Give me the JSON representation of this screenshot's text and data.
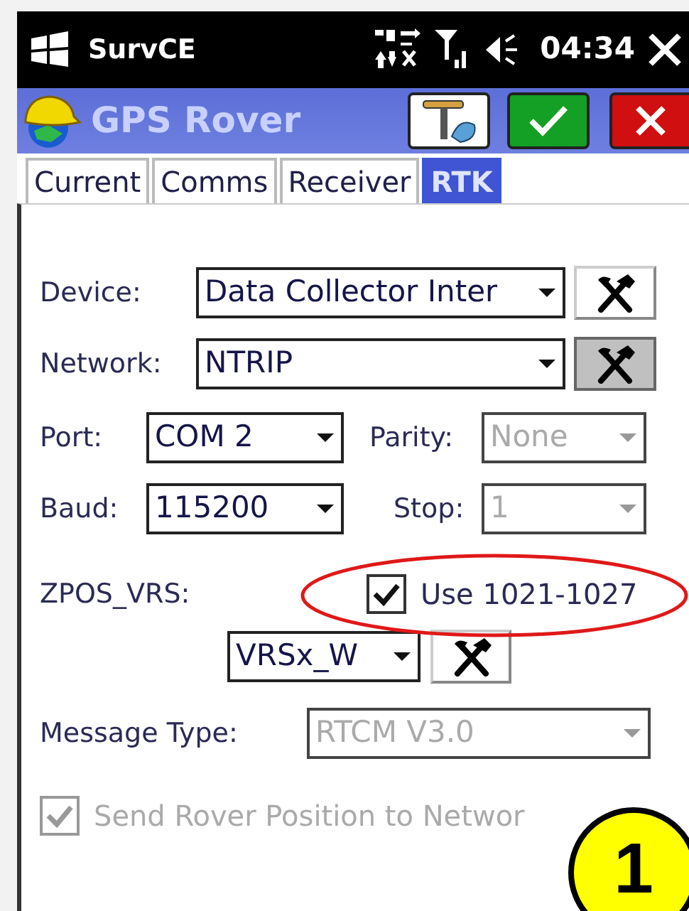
{
  "status_bar": {
    "app_name": "SurvCE",
    "time": "04:34"
  },
  "title_bar": {
    "title": "GPS Rover"
  },
  "tabs": [
    {
      "label": "Current",
      "selected": false
    },
    {
      "label": "Comms",
      "selected": false
    },
    {
      "label": "Receiver",
      "selected": false
    },
    {
      "label": "RTK",
      "selected": true
    }
  ],
  "rows": [
    {
      "items": [
        {
          "kind": "label",
          "text": "Device:"
        },
        {
          "kind": "select",
          "value": "Data Collector Inter",
          "disabled": false
        },
        {
          "kind": "tool",
          "pressed": false
        }
      ]
    },
    {
      "items": [
        {
          "kind": "label",
          "text": "Network:"
        },
        {
          "kind": "select",
          "value": "NTRIP",
          "disabled": false
        },
        {
          "kind": "tool",
          "pressed": true
        }
      ]
    },
    {
      "items": [
        {
          "kind": "label",
          "text": "Port:"
        },
        {
          "kind": "select",
          "value": "COM 2",
          "disabled": false
        },
        {
          "kind": "label",
          "text": "Parity:"
        },
        {
          "kind": "select",
          "value": "None",
          "disabled": true
        }
      ]
    },
    {
      "items": [
        {
          "kind": "label",
          "text": "Baud:"
        },
        {
          "kind": "select",
          "value": "115200",
          "disabled": false
        },
        {
          "kind": "label",
          "text": "Stop:"
        },
        {
          "kind": "select",
          "value": "1",
          "disabled": true
        }
      ]
    },
    {
      "items": [
        {
          "kind": "label",
          "text": "ZPOS_VRS:"
        },
        {
          "kind": "checkbox",
          "text": "Use 1021-1027",
          "checked": true,
          "disabled": false,
          "highlighted": true
        }
      ]
    },
    {
      "items": [
        {
          "kind": "select",
          "value": "VRSx_W",
          "disabled": false
        },
        {
          "kind": "tool",
          "pressed": false
        }
      ]
    },
    {
      "items": [
        {
          "kind": "label",
          "text": "Message Type:"
        },
        {
          "kind": "select",
          "value": "RTCM V3.0",
          "disabled": true
        }
      ]
    },
    {
      "items": [
        {
          "kind": "checkbox",
          "text": "Send Rover Position to Networ",
          "checked": true,
          "disabled": true,
          "highlighted": false
        }
      ]
    }
  ],
  "callout": {
    "text": "1"
  }
}
